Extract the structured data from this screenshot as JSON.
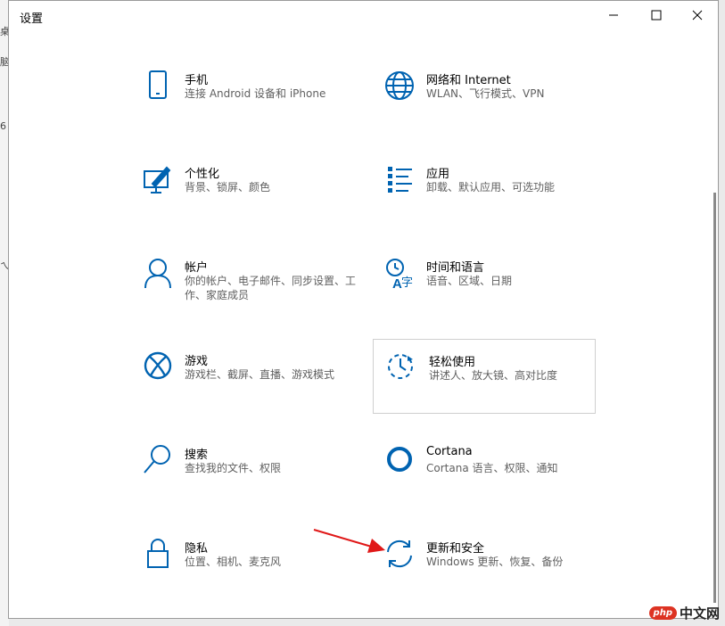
{
  "window": {
    "title": "设置"
  },
  "accent": "#0063b1",
  "settings": [
    {
      "name": "手机",
      "desc": "连接 Android 设备和 iPhone",
      "icon": "phone-icon"
    },
    {
      "name": "网络和 Internet",
      "desc": "WLAN、飞行模式、VPN",
      "icon": "globe-icon"
    },
    {
      "name": "个性化",
      "desc": "背景、锁屏、颜色",
      "icon": "personalization-icon"
    },
    {
      "name": "应用",
      "desc": "卸载、默认应用、可选功能",
      "icon": "apps-list-icon"
    },
    {
      "name": "帐户",
      "desc": "你的帐户、电子邮件、同步设置、工作、家庭成员",
      "icon": "person-icon"
    },
    {
      "name": "时间和语言",
      "desc": "语音、区域、日期",
      "icon": "time-language-icon"
    },
    {
      "name": "游戏",
      "desc": "游戏栏、截屏、直播、游戏模式",
      "icon": "xbox-icon"
    },
    {
      "name": "轻松使用",
      "desc": "讲述人、放大镜、高对比度",
      "icon": "ease-of-access-icon"
    },
    {
      "name": "搜索",
      "desc": "查找我的文件、权限",
      "icon": "search-icon"
    },
    {
      "name": "Cortana",
      "desc": "Cortana 语言、权限、通知",
      "icon": "cortana-icon"
    },
    {
      "name": "隐私",
      "desc": "位置、相机、麦克风",
      "icon": "lock-icon"
    },
    {
      "name": "更新和安全",
      "desc": "Windows 更新、恢复、备份",
      "icon": "sync-icon"
    }
  ],
  "background_window": {
    "fragments": [
      "桌",
      "脑",
      "6",
      "ㄟ"
    ]
  },
  "watermark": {
    "badge": "php",
    "text": "中文网"
  }
}
